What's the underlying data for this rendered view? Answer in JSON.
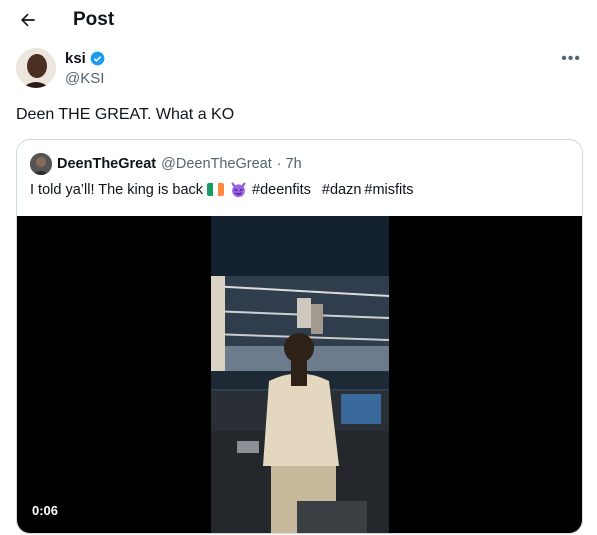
{
  "header": {
    "title": "Post"
  },
  "tweet": {
    "author_name": "ksi",
    "author_handle": "@KSI",
    "text": "Deen THE GREAT. What a KO"
  },
  "quote": {
    "author_name": "DeenTheGreat",
    "author_handle": "@DeenTheGreat",
    "time": "· 7h",
    "text_before": "I told ya’ll! The king is back",
    "hashtags": [
      "#deenfits",
      "#dazn",
      "#misfits"
    ],
    "video_time": "0:06"
  },
  "icons": [
    "back-arrow-icon",
    "verified-badge-icon",
    "more-icon",
    "irish-flag-emoji",
    "devil-emoji"
  ],
  "colors": {
    "text": "#0f1419",
    "muted": "#536471",
    "verified": "#1d9bf0",
    "border": "#cfd9de"
  }
}
